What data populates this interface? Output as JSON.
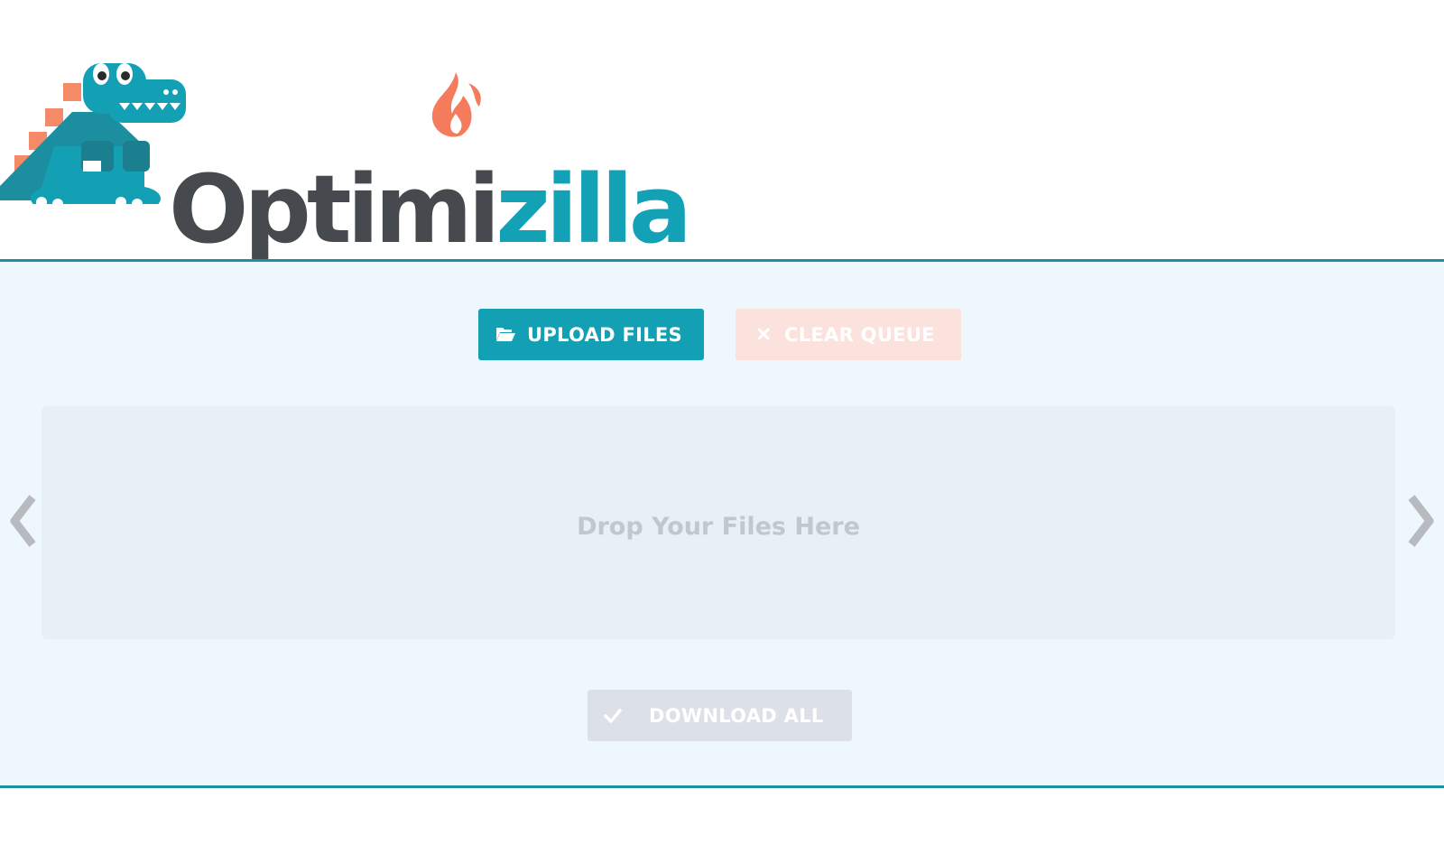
{
  "logo": {
    "text_part1": "Optimi",
    "text_part2": "zilla",
    "mascot_icon": "dinosaur-icon",
    "flame_icon": "flame-icon"
  },
  "toolbar": {
    "upload_label": "UPLOAD FILES",
    "upload_icon": "folder-open-icon",
    "clear_label": "CLEAR QUEUE",
    "clear_icon": "close-icon"
  },
  "dropzone": {
    "text": "Drop Your Files Here"
  },
  "carousel": {
    "prev_icon": "chevron-left-icon",
    "next_icon": "chevron-right-icon"
  },
  "download": {
    "label": "DOWNLOAD ALL",
    "icon": "check-icon"
  },
  "colors": {
    "brand_teal": "#13a0b5",
    "brand_dark": "#46494d",
    "accent_orange": "#f47c5c",
    "panel_bg": "#eef7fd",
    "border": "#1f8ea1"
  }
}
